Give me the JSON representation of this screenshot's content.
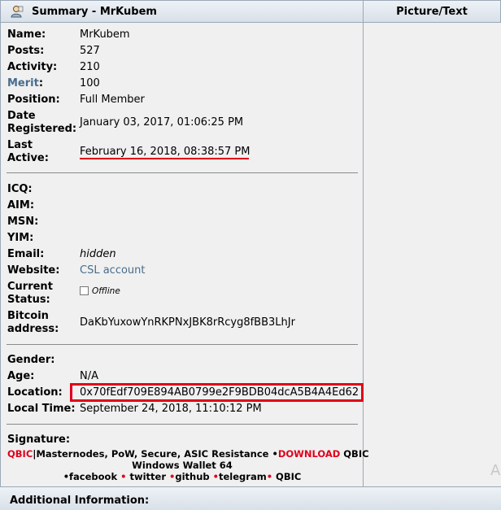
{
  "header": {
    "summary_title": "Summary - MrKubem",
    "picture_title": "Picture/Text"
  },
  "profile": {
    "name_label": "Name:",
    "name": "MrKubem",
    "posts_label": "Posts:",
    "posts": "527",
    "activity_label": "Activity:",
    "activity": "210",
    "merit_label": "Merit",
    "merit_colon": ":",
    "merit": "100",
    "position_label": "Position:",
    "position": "Full Member",
    "date_registered_label_1": "Date",
    "date_registered_label_2": "Registered:",
    "date_registered": "January 03, 2017, 01:06:25 PM",
    "last_active_label_1": "Last",
    "last_active_label_2": "Active:",
    "last_active": "February 16, 2018, 08:38:57 PM",
    "icq_label": "ICQ:",
    "aim_label": "AIM:",
    "msn_label": "MSN:",
    "yim_label": "YIM:",
    "email_label": "Email:",
    "email": "hidden",
    "website_label": "Website:",
    "website": "CSL account",
    "status_label_1": "Current",
    "status_label_2": "Status:",
    "status": "Offline",
    "bitcoin_label_1": "Bitcoin",
    "bitcoin_label_2": "address:",
    "bitcoin": "DaKbYuxowYnRKPNxJBK8rRcyg8fBB3LhJr",
    "gender_label": "Gender:",
    "age_label": "Age:",
    "age": "N/A",
    "location_label": "Location:",
    "location": "0x70fEdf709E894AB0799e2F9BDB04dcA5B4A4Ed62",
    "local_time_label": "Local Time:",
    "local_time": "September 24, 2018, 11:10:12 PM",
    "signature_label": "Signature:"
  },
  "signature": {
    "qbic": "QBIC",
    "line1_rest": "|Masternodes, PoW, Secure, ASIC Resistance •",
    "download": "DOWNLOAD",
    "line1_tail": " QBIC",
    "line2": "Windows Wallet 64",
    "facebook": "•facebook",
    "bullet1": " • ",
    "twitter": " twitter",
    "bullet2": " •",
    "github": "github",
    "bullet3": " •",
    "telegram": "telegram",
    "bullet4": "•",
    "qbic_tail": " QBIC"
  },
  "footer": {
    "additional_info": "Additional Information:"
  },
  "overlay": {
    "ghost_text": "A"
  }
}
